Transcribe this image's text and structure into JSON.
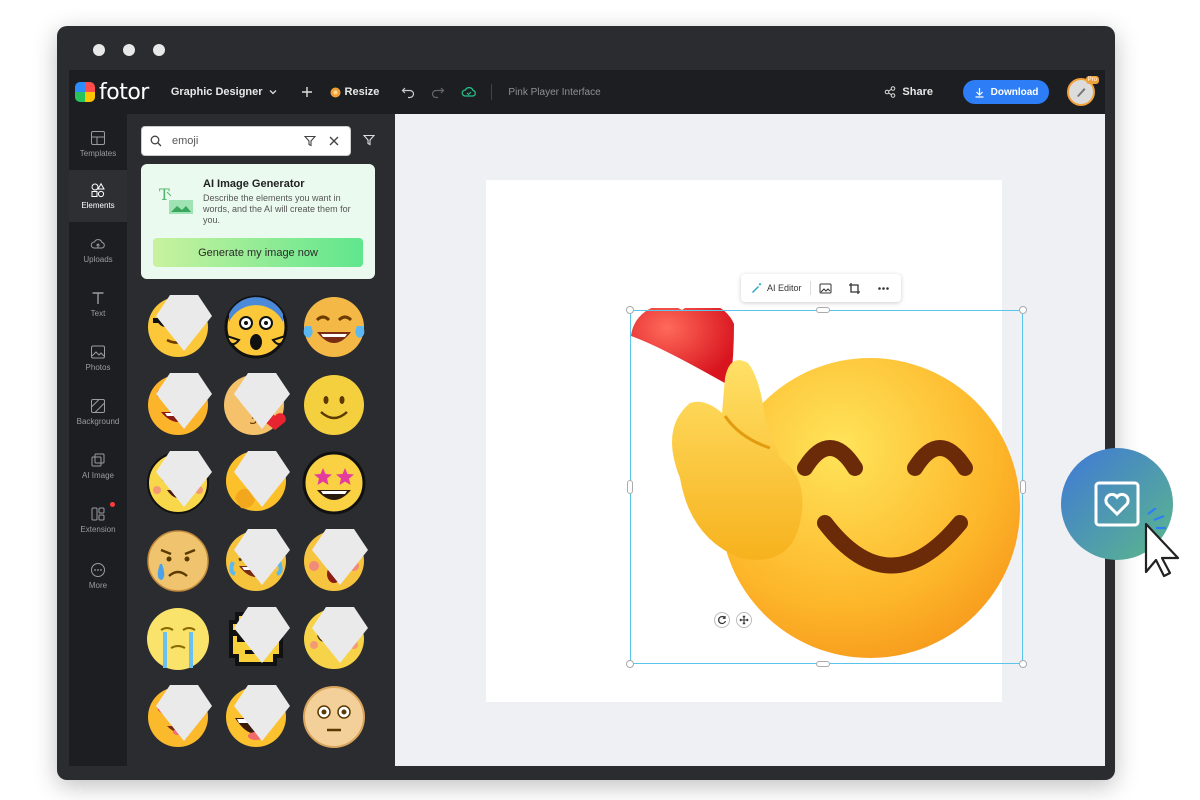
{
  "app": {
    "logo_text": "fotor",
    "mode_label": "Graphic Designer",
    "resize_label": "Resize",
    "doc_name": "Pink Player Interface",
    "share_label": "Share",
    "download_label": "Download",
    "avatar_badge": "Pro"
  },
  "rail": {
    "items": [
      {
        "label": "Templates"
      },
      {
        "label": "Elements"
      },
      {
        "label": "Uploads"
      },
      {
        "label": "Text"
      },
      {
        "label": "Photos"
      },
      {
        "label": "Background"
      },
      {
        "label": "AI Image"
      },
      {
        "label": "Extension"
      },
      {
        "label": "More"
      }
    ]
  },
  "panel": {
    "search_value": "emoji",
    "ai_card": {
      "title": "AI Image Generator",
      "description": "Describe the elements you want in words, and the AI will create them for you.",
      "button_label": "Generate my image now"
    },
    "emojis": [
      "sunglasses-emoji",
      "scream-emoji",
      "tears-of-joy-emoji",
      "heart-eyes-emoji",
      "kissing-heart-emoji",
      "smiley-emoji",
      "grinning-blush-emoji",
      "thinking-emoji",
      "star-struck-emoji",
      "crying-emoji",
      "laughing-squint-emoji",
      "astonished-emoji",
      "loudly-crying-emoji",
      "pixel-sunglasses-emoji",
      "dizzy-eyes-emoji",
      "heart-eyes-smile-emoji",
      "big-grin-emoji",
      "flushed-emoji"
    ]
  },
  "canvas": {
    "toolbar": {
      "ai_editor_label": "AI Editor"
    }
  },
  "colors": {
    "accent": "#2d7df6",
    "selection": "#5ac4ea",
    "ai_card_bg": "#eafaee"
  }
}
